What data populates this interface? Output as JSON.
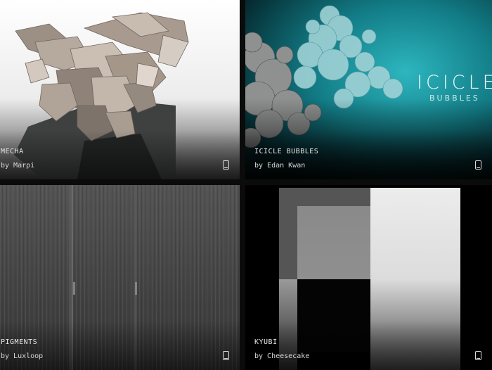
{
  "experiments": [
    {
      "title": "MECHA",
      "author": "by Marpi",
      "device_icon": "mobile-device-icon"
    },
    {
      "title": "ICICLE BUBBLES",
      "author": "by Edan Kwan",
      "device_icon": "mobile-device-icon",
      "artwork_text": {
        "word": "ICICLE",
        "sub": "BUBBLES"
      }
    },
    {
      "title": "PIGMENTS",
      "author": "by Luxloop",
      "device_icon": "mobile-device-icon"
    },
    {
      "title": "KYUBI",
      "author": "by Cheesecake",
      "device_icon": "mobile-device-icon"
    }
  ],
  "colors": {
    "background": "#0b0b0b",
    "icicle_teal": "#138a96",
    "mecha_bone": "#b7a79a"
  }
}
